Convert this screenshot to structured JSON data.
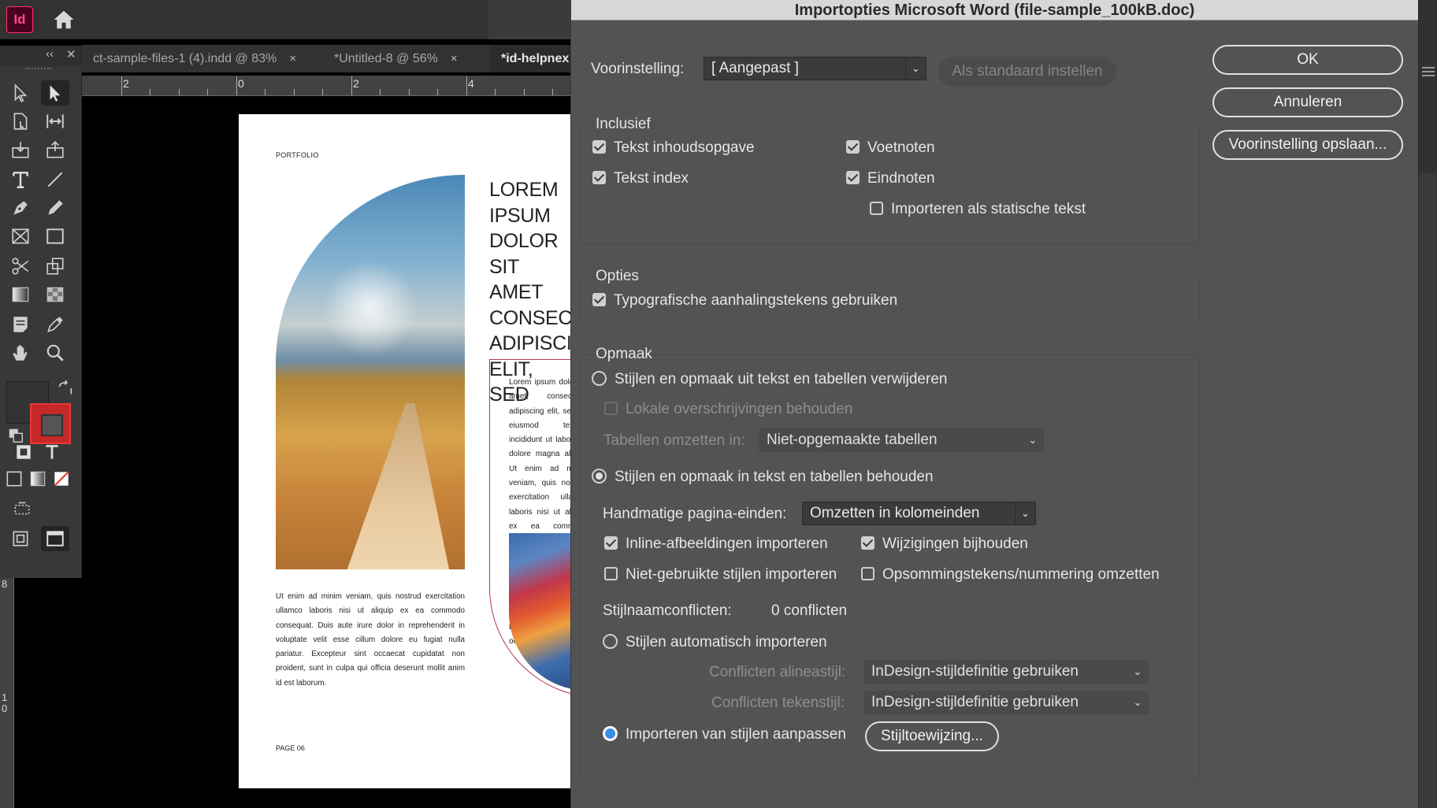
{
  "app": {
    "logo": "Id"
  },
  "tabs": [
    {
      "label": "ct-sample-files-1 (4).indd @ 83%",
      "close": "×"
    },
    {
      "label": "*Untitled-8 @ 56%",
      "close": "×"
    },
    {
      "label": "*id-helpnex"
    }
  ],
  "toolbox": {
    "collapse": "‹‹",
    "close": "✕"
  },
  "ruler": {
    "h": [
      "2",
      "0",
      "2",
      "4"
    ],
    "v": [
      "8",
      "1",
      "0"
    ]
  },
  "page": {
    "label": "PORTFOLIO",
    "headline": "LOREM IPSUM DOLOR SIT AMET CONSECTETUR ADIPISCING ELIT, SED",
    "frame_text": "Lorem ipsum dolor sit amet, consectetur adipiscing elit, sed do eiusmod tempor incididunt ut labore et dolore magna aliqua. Ut enim ad minim veniam, quis nostrud exercitation ullamco laboris nisi ut aliquip ex ea commodo consequat. Duis aute irure dolor in reprehenderit in voluptate velit esse cillum dolore eu fugiat nulla pariatur. Excepteur sint occaecat",
    "body": "Ut enim ad minim veniam, quis nostrud exercitation ullamco laboris nisi ut aliquip ex ea commodo consequat. Duis aute irure dolor in reprehenderit in voluptate velit esse cillum dolore eu fugiat nulla pariatur. Excepteur sint occaecat cupidatat non proident, sunt in culpa qui officia deserunt mollit anim id est laborum.",
    "page_number": "PAGE 06"
  },
  "dialog": {
    "title": "Importopties Microsoft Word (file-sample_100kB.doc)",
    "preset_label": "Voorinstelling:",
    "preset_value": "[ Aangepast ]",
    "set_default": "Als standaard instellen",
    "ok": "OK",
    "cancel": "Annuleren",
    "save_preset": "Voorinstelling opslaan...",
    "include": {
      "title": "Inclusief",
      "toc_text": "Tekst inhoudsopgave",
      "index_text": "Tekst index",
      "footnotes": "Voetnoten",
      "endnotes": "Eindnoten",
      "static_text": "Importeren als statische tekst"
    },
    "options": {
      "title": "Opties",
      "typographic_quotes": "Typografische aanhalingstekens gebruiken"
    },
    "format": {
      "title": "Opmaak",
      "remove_styles": "Stijlen en opmaak uit tekst en tabellen verwijderen",
      "keep_local_overrides": "Lokale overschrijvingen behouden",
      "convert_tables_label": "Tabellen omzetten in:",
      "convert_tables_value": "Niet-opgemaakte tabellen",
      "keep_styles": "Stijlen en opmaak in tekst en tabellen behouden",
      "page_breaks_label": "Handmatige pagina-einden:",
      "page_breaks_value": "Omzetten in kolomeinden",
      "inline_images": "Inline-afbeeldingen importeren",
      "track_changes": "Wijzigingen bijhouden",
      "unused_styles": "Niet-gebruikte stijlen importeren",
      "convert_bullets": "Opsommingstekens/nummering omzetten",
      "conflicts_label": "Stijlnaamconflicten:",
      "conflicts_value": "0 conflicten",
      "auto_import": "Stijlen automatisch importeren",
      "para_conflicts_label": "Conflicten alineastijl:",
      "para_conflicts_value": "InDesign-stijldefinitie gebruiken",
      "char_conflicts_label": "Conflicten tekenstijl:",
      "char_conflicts_value": "InDesign-stijldefinitie gebruiken",
      "customize_import": "Importeren van stijlen aanpassen",
      "style_mapping": "Stijltoewijzing..."
    }
  }
}
